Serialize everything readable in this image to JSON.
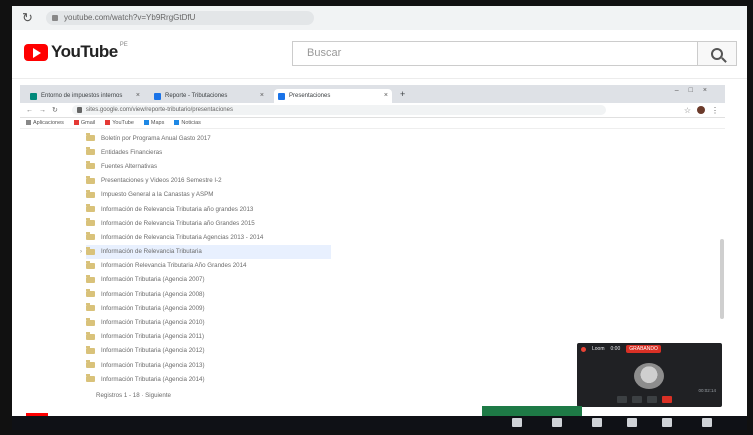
{
  "youtube": {
    "logo_text": "YouTube",
    "country_code": "PE",
    "search_placeholder": "Buscar"
  },
  "outer_browser": {
    "url": "youtube.com/watch?v=Yb9RrgGtDfU"
  },
  "inner_browser": {
    "tabs": [
      {
        "label": "Entorno de impuestos internos",
        "active": false
      },
      {
        "label": "Reporte - Tributaciones",
        "active": false
      },
      {
        "label": "Presentaciones",
        "active": true
      }
    ],
    "address": "sites.google.com/view/reporte-tributario/presentaciones",
    "bookmarks": [
      "Aplicaciones",
      "Gmail",
      "YouTube",
      "Maps",
      "Noticias"
    ]
  },
  "listing": {
    "rows": [
      "Boletín por Programa Anual Gasto 2017",
      "Entidades Financieras",
      "Fuentes Alternativas",
      "Presentaciones y Videos 2016 Semestre I-2",
      "Impuesto General a la Canastas y ASPM",
      "Información de Relevancia Tributaria año grandes 2013",
      "Información de Relevancia Tributaria año Grandes 2015",
      "Información de Relevancia Tributaria Agencias 2013 - 2014",
      "Información de Relevancia Tributaria",
      "Información Relevancia Tributaria Año Grandes 2014",
      "Información Tributaria (Agencia 2007)",
      "Información Tributaria (Agencia 2008)",
      "Información Tributaria (Agencia 2009)",
      "Información Tributaria (Agencia 2010)",
      "Información Tributaria (Agencia 2011)",
      "Información Tributaria (Agencia 2012)",
      "Información Tributaria (Agencia 2013)",
      "Información Tributaria (Agencia 2014)"
    ],
    "selected_index": 8,
    "footer": "Registros 1 - 18 · Siguiente"
  },
  "webcam": {
    "title": "Loom",
    "status": "0:00",
    "live_label": "GRABANDO",
    "time": "00:02:14"
  },
  "colors": {
    "youtube_red": "#ff0000",
    "folder": "#d9c27a",
    "selected_row": "#e8f0fe",
    "excel_green": "#1e7a46"
  }
}
